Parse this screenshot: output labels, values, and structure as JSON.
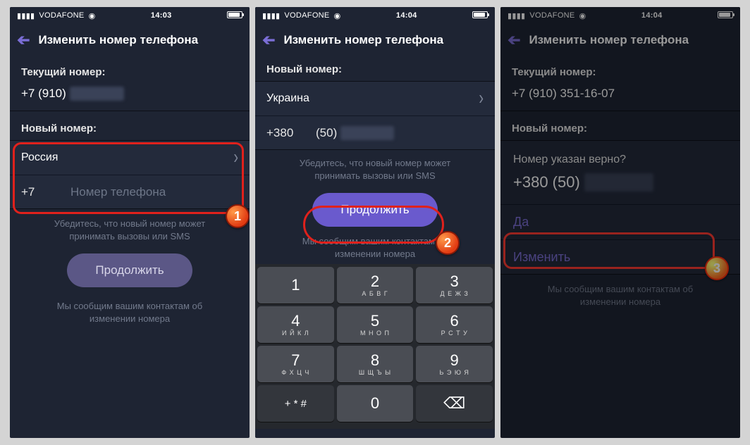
{
  "status": {
    "carrier": "VODAFONE",
    "wifi_icon": "wifi-icon"
  },
  "screens": [
    {
      "time": "14:03",
      "title": "Изменить номер телефона",
      "current_label": "Текущий номер:",
      "current_value_prefix": "+7 (910)",
      "current_value_blur": "000-00-00",
      "new_label": "Новый номер:",
      "country": "Россия",
      "code": "+7",
      "phone_placeholder": "Номер телефона",
      "helper1_l1": "Убедитесь, что новый номер может",
      "helper1_l2": "принимать вызовы или SMS",
      "continue_label": "Продолжить",
      "helper2_l1": "Мы сообщим вашим контактам об",
      "helper2_l2": "изменении номера",
      "step": "1"
    },
    {
      "time": "14:04",
      "title": "Изменить номер телефона",
      "new_label": "Новый номер:",
      "country": "Украина",
      "code": "+380",
      "phone_area": "(50)",
      "phone_blur": "000 00 00",
      "helper1_l1": "Убедитесь, что новый номер может",
      "helper1_l2": "принимать вызовы или SMS",
      "continue_label": "Продолжить",
      "helper2_l1": "Мы сообщим вашим контактам об",
      "helper2_l2": "изменении номера",
      "step": "2",
      "keypad": {
        "rows": [
          [
            {
              "d": "1",
              "l": ""
            },
            {
              "d": "2",
              "l": "А Б В Г"
            },
            {
              "d": "3",
              "l": "Д Е Ж З"
            }
          ],
          [
            {
              "d": "4",
              "l": "И Й К Л"
            },
            {
              "d": "5",
              "l": "М Н О П"
            },
            {
              "d": "6",
              "l": "Р С Т У"
            }
          ],
          [
            {
              "d": "7",
              "l": "Ф Х Ц Ч"
            },
            {
              "d": "8",
              "l": "Ш Щ Ъ Ы"
            },
            {
              "d": "9",
              "l": "Ь Э Ю Я"
            }
          ]
        ],
        "bottom": {
          "plus": "+ * #",
          "zero": "0",
          "del": "⌫"
        }
      }
    },
    {
      "time": "14:04",
      "title": "Изменить номер телефона",
      "current_label": "Текущий номер:",
      "current_value": "+7 (910) 351-16-07",
      "new_label": "Новый номер:",
      "confirm_q": "Номер указан верно?",
      "confirm_number_prefix": "+380 (50)",
      "confirm_number_blur": "000 00 00",
      "yes_label": "Да",
      "change_label": "Изменить",
      "helper2_l1": "Мы сообщим вашим контактам об",
      "helper2_l2": "изменении номера",
      "step": "3"
    }
  ]
}
